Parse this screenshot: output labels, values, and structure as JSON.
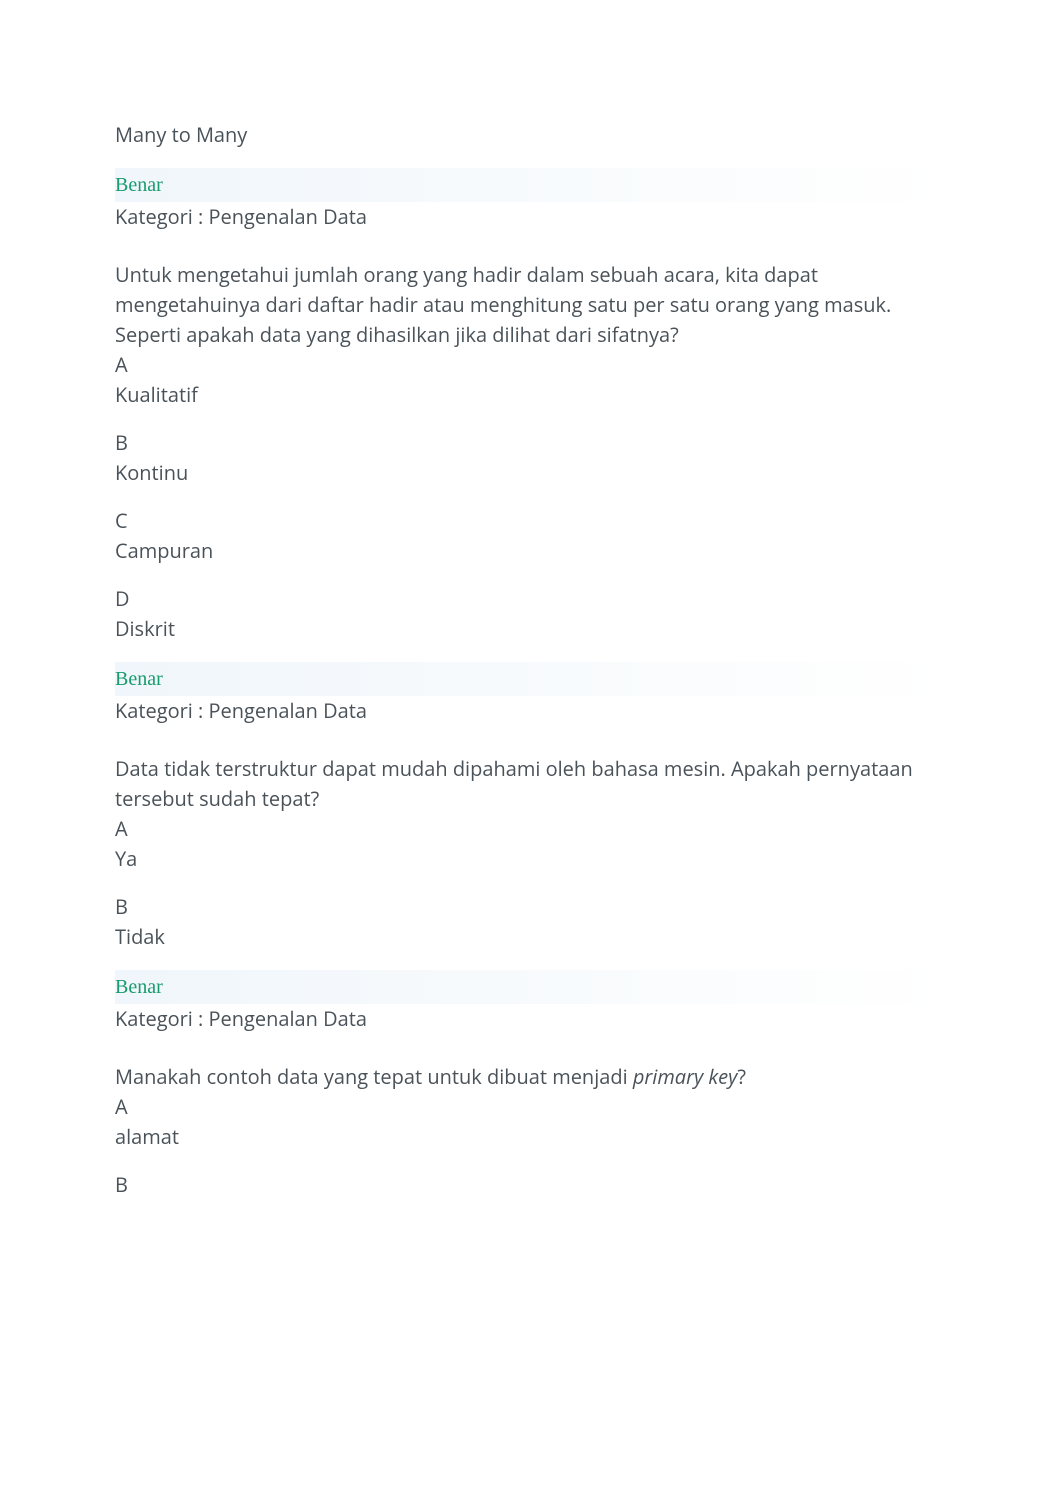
{
  "q1": {
    "visibleOption": "Many to Many",
    "status": "Benar",
    "category": "Kategori : Pengenalan Data"
  },
  "q2": {
    "line1": "Untuk mengetahui jumlah orang yang hadir dalam sebuah acara, kita dapat mengetahuinya dari daftar hadir atau menghitung satu per satu orang yang masuk.",
    "line2": "Seperti apakah data yang dihasilkan jika dilihat dari sifatnya?",
    "options": {
      "A": {
        "letter": "A",
        "label": "Kualitatif"
      },
      "B": {
        "letter": "B",
        "label": "Kontinu"
      },
      "C": {
        "letter": "C",
        "label": "Campuran"
      },
      "D": {
        "letter": "D",
        "label": "Diskrit"
      }
    },
    "status": "Benar",
    "category": "Kategori : Pengenalan Data"
  },
  "q3": {
    "line1": "Data tidak terstruktur dapat mudah dipahami oleh bahasa mesin. Apakah pernyataan tersebut sudah tepat?",
    "options": {
      "A": {
        "letter": "A",
        "label": "Ya"
      },
      "B": {
        "letter": "B",
        "label": "Tidak"
      }
    },
    "status": "Benar",
    "category": "Kategori : Pengenalan Data"
  },
  "q4": {
    "line1_pre": "Manakah contoh data yang tepat untuk dibuat menjadi ",
    "line1_italic": "primary key",
    "line1_post": "?",
    "options": {
      "A": {
        "letter": "A",
        "label": "alamat"
      },
      "B": {
        "letter": "B"
      }
    }
  }
}
